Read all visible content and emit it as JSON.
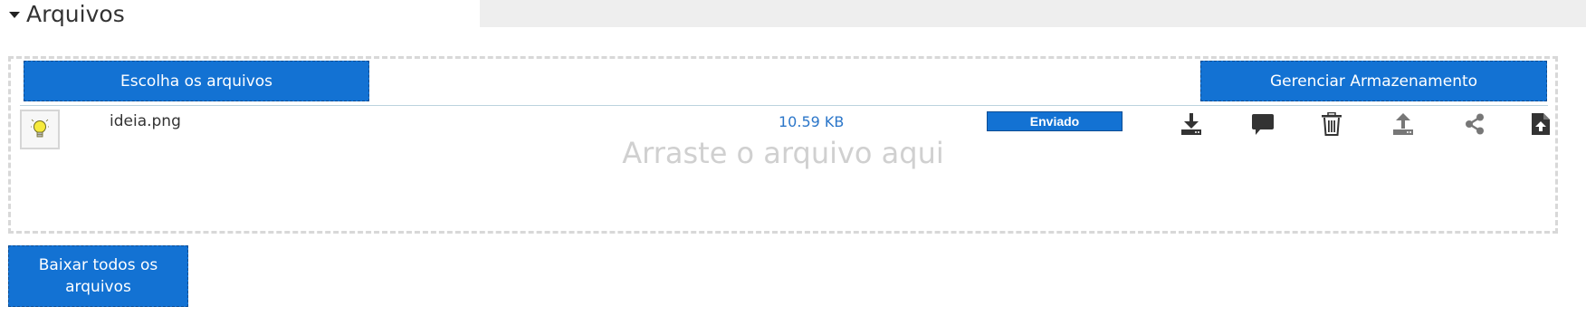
{
  "section": {
    "title": "Arquivos"
  },
  "upload": {
    "choose_label": "Escolha os arquivos",
    "manage_label": "Gerenciar Armazenamento",
    "drop_hint": "Arraste o arquivo aqui"
  },
  "files": [
    {
      "thumb_icon": "lightbulb-icon",
      "name": "ideia.png",
      "size": "10.59 KB",
      "status": "Enviado",
      "actions": [
        "download-icon",
        "comment-icon",
        "trash-icon",
        "upload-icon",
        "share-icon",
        "file-upload-icon"
      ]
    }
  ],
  "footer": {
    "download_all_label": "Baixar todos os arquivos"
  },
  "colors": {
    "accent": "#1372d3",
    "size_text": "#2b76c9",
    "icon": "#333333",
    "dropzone_border": "#d8d8d8"
  }
}
